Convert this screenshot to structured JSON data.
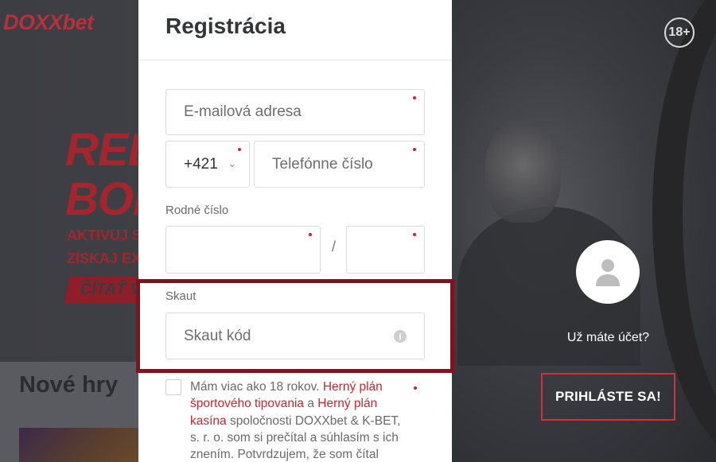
{
  "background": {
    "logo": "DOXXbet",
    "promo_line1": "REL",
    "promo_line2": "BON",
    "promo_line3": "AKTIVUJ SI K",
    "promo_line4": "ZÍSKAJ EXTR",
    "promo_button": "ČÍTAŤ V",
    "games_title": "Nové hry",
    "age_badge": "18+",
    "login_question": "Už máte účet?",
    "login_button": "PRIHLÁSTE SA!"
  },
  "modal": {
    "title": "Registrácia",
    "email_placeholder": "E-mailová adresa",
    "phone_prefix": "+421",
    "phone_placeholder": "Telefónne číslo",
    "birth_number_label": "Rodné číslo",
    "birth_number_separator": "/",
    "scout_label": "Skaut",
    "scout_placeholder": "Skaut kód",
    "terms": {
      "text1": "Mám viac ako 18 rokov. ",
      "link1": "Herný plán športového tipovania",
      "text2": " a ",
      "link2": "Herný plán kasína",
      "text3": " spoločnosti DOXXbet & K-BET, s. r. o. som si prečítal a súhlasím s ich znením. Potvrdzujem, že som čítal všetky"
    }
  },
  "colors": {
    "accent": "#d6222f",
    "highlight_frame": "#7f1420",
    "background": "#3a3b40"
  },
  "icons": [
    "chevron-down-icon",
    "info-icon",
    "user-avatar-icon",
    "age-restriction-icon"
  ]
}
